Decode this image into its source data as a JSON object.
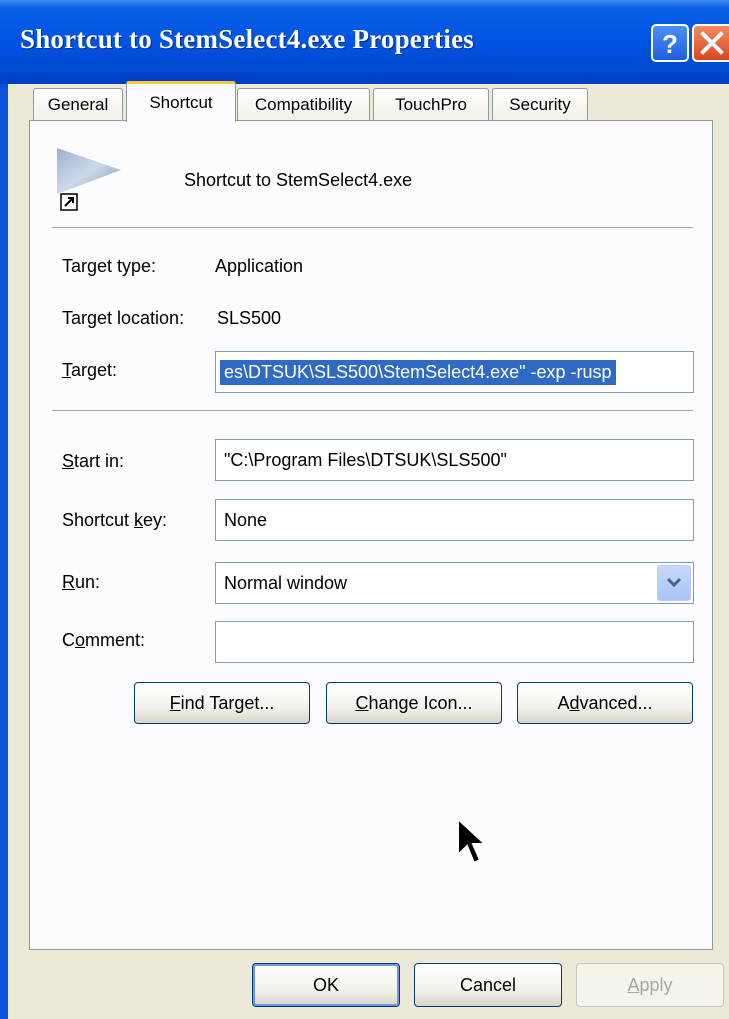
{
  "window": {
    "title": "Shortcut to StemSelect4.exe Properties",
    "help_icon": "question-mark",
    "close_icon": "close-x"
  },
  "tabs": [
    {
      "label": "General"
    },
    {
      "label": "Shortcut",
      "active": true
    },
    {
      "label": "Compatibility"
    },
    {
      "label": "TouchPro"
    },
    {
      "label": "Security"
    }
  ],
  "header": {
    "icon": "shortcut-app-icon",
    "name": "Shortcut to StemSelect4.exe"
  },
  "info": {
    "target_type_label": "Target type:",
    "target_type_value": "Application",
    "target_location_label": "Target location:",
    "target_location_value": "SLS500"
  },
  "fields": {
    "target": {
      "label_mnemonic": "T",
      "label_rest": "arget:",
      "value": "es\\DTSUK\\SLS500\\StemSelect4.exe\" -exp -rusp"
    },
    "start_in": {
      "label_mnemonic": "S",
      "label_rest": "tart in:",
      "value": "\"C:\\Program Files\\DTSUK\\SLS500\""
    },
    "shortcut_key": {
      "label_pre": "Shortcut ",
      "label_mnemonic": "k",
      "label_rest": "ey:",
      "value": "None"
    },
    "run": {
      "label_mnemonic": "R",
      "label_rest": "un:",
      "value": "Normal window"
    },
    "comment": {
      "label_pre": "C",
      "label_mnemonic": "o",
      "label_rest": "mment:",
      "value": ""
    }
  },
  "buttons": {
    "find_target": {
      "mnemonic": "F",
      "rest": "ind Target..."
    },
    "change_icon": {
      "mnemonic": "C",
      "rest": "hange Icon..."
    },
    "advanced": {
      "pre": "A",
      "mnemonic": "d",
      "rest": "vanced..."
    },
    "ok": "OK",
    "cancel": "Cancel",
    "apply": {
      "mnemonic": "A",
      "rest": "pply"
    }
  },
  "colors": {
    "titlebar": "#0055e5",
    "selection": "#316ac5",
    "dialog_bg": "#ece9d8"
  }
}
